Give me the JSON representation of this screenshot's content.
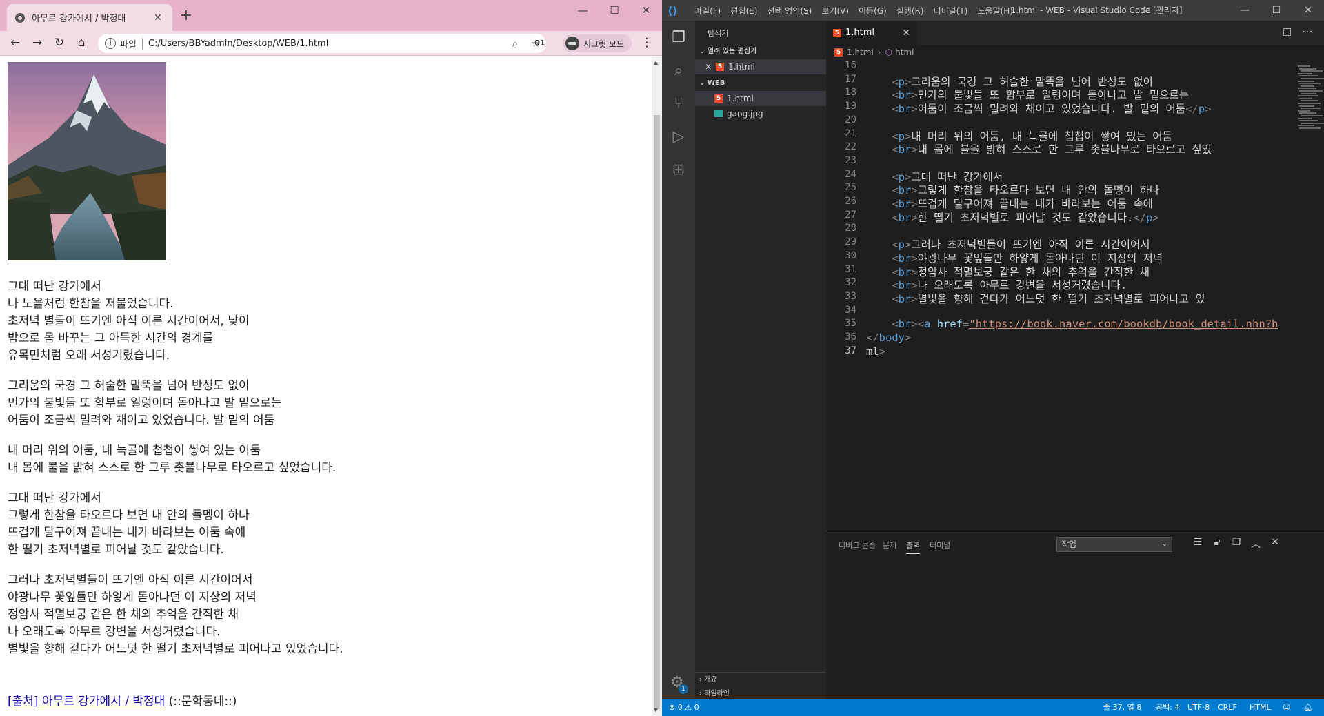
{
  "chrome": {
    "tab_title": "아무르 강가에서 / 박정대",
    "tab_close": "✕",
    "new_tab": "+",
    "win_min": "—",
    "win_max": "☐",
    "win_close": "✕",
    "back": "←",
    "forward": "→",
    "reload": "↻",
    "home": "⌂",
    "omnibox_label": "파일",
    "url": "C:/Users/BBYadmin/Desktop/WEB/1.html",
    "extension_badge": "01",
    "incognito_label": "시크릿 모드",
    "menu": "⋮"
  },
  "page": {
    "stanzas": [
      [
        "그대 떠난 강가에서",
        "나 노을처럼 한참을 저물었습니다.",
        "초저녁 별들이 뜨기엔 아직 이른 시간이어서, 낮이",
        "밤으로 몸 바꾸는 그 아득한 시간의 경계를",
        "유목민처럼 오래 서성거렸습니다."
      ],
      [
        "그리움의 국경 그 허술한 말뚝을 넘어 반성도 없이",
        "민가의 불빛들 또 함부로 일렁이며 돋아나고 발 밑으로는",
        "어둠이 조금씩 밀려와 채이고 있었습니다. 발 밑의 어둠"
      ],
      [
        "내 머리 위의 어둠, 내 늑골에 첩첩이 쌓여 있는 어둠",
        "내 몸에 불을 밝혀 스스로 한 그루 촛불나무로 타오르고 싶었습니다."
      ],
      [
        "그대 떠난 강가에서",
        "그렇게 한참을 타오르다 보면 내 안의 돌멩이 하나",
        "뜨겁게 달구어져 끝내는 내가 바라보는 어둠 속에",
        "한 떨기 초저녁별로 피어날 것도 같았습니다."
      ],
      [
        "그러나 초저녁별들이 뜨기엔 아직 이른 시간이어서",
        "야광나무 꽃잎들만 하얗게 돋아나던 이 지상의 저녁",
        "정암사 적멸보궁 같은 한 채의 추억을 간직한 채",
        "나 오래도록 아무르 강변을 서성거렸습니다.",
        "별빛을 향해 걷다가 어느덧 한 떨기 초저녁별로 피어나고 있었습니다."
      ]
    ],
    "source_link": "[출처] 아무르 강가에서 / 박정대",
    "source_suffix": " (::문학동네::)"
  },
  "vscode": {
    "menus": [
      "파일(F)",
      "편집(E)",
      "선택 영역(S)",
      "보기(V)",
      "이동(G)",
      "실행(R)",
      "터미널(T)",
      "도움말(H)"
    ],
    "title": "1.html - WEB - Visual Studio Code [관리자]",
    "sidebar_title": "탐색기",
    "open_editors": "열려 있는 편집기",
    "open_file": "1.html",
    "folder": "WEB",
    "files": [
      "1.html",
      "gang.jpg"
    ],
    "outline": "개요",
    "timeline": "타임라인",
    "editor_tab": "1.html",
    "breadcrumb_file": "1.html",
    "breadcrumb_node": "html",
    "code_lines": [
      {
        "n": "16",
        "t": ""
      },
      {
        "n": "17",
        "t": "    <p>그리움의 국경 그 허술한 말뚝을 넘어 반성도 없이"
      },
      {
        "n": "18",
        "t": "    <br>민가의 불빛들 또 함부로 일렁이며 돋아나고 발 밑으로는"
      },
      {
        "n": "19",
        "t": "    <br>어둠이 조금씩 밀려와 채이고 있었습니다. 발 밑의 어둠</p>"
      },
      {
        "n": "20",
        "t": ""
      },
      {
        "n": "21",
        "t": "    <p>내 머리 위의 어둠, 내 늑골에 첩첩이 쌓여 있는 어둠"
      },
      {
        "n": "22",
        "t": "    <br>내 몸에 불을 밝혀 스스로 한 그루 촛불나무로 타오르고 싶었"
      },
      {
        "n": "23",
        "t": ""
      },
      {
        "n": "24",
        "t": "    <p>그대 떠난 강가에서"
      },
      {
        "n": "25",
        "t": "    <br>그렇게 한참을 타오르다 보면 내 안의 돌멩이 하나"
      },
      {
        "n": "26",
        "t": "    <br>뜨겁게 달구어져 끝내는 내가 바라보는 어둠 속에"
      },
      {
        "n": "27",
        "t": "    <br>한 떨기 초저녁별로 피어날 것도 같았습니다.</p>"
      },
      {
        "n": "28",
        "t": ""
      },
      {
        "n": "29",
        "t": "    <p>그러나 초저녁별들이 뜨기엔 아직 이른 시간이어서"
      },
      {
        "n": "30",
        "t": "    <br>야광나무 꽃잎들만 하얗게 돋아나던 이 지상의 저녁"
      },
      {
        "n": "31",
        "t": "    <br>정암사 적멸보궁 같은 한 채의 추억을 간직한 채"
      },
      {
        "n": "32",
        "t": "    <br>나 오래도록 아무르 강변을 서성거렸습니다."
      },
      {
        "n": "33",
        "t": "    <br>별빛을 향해 걷다가 어느덧 한 떨기 초저녁별로 피어나고 있"
      },
      {
        "n": "34",
        "t": ""
      },
      {
        "n": "35",
        "t": "    <br><a href=\"https://book.naver.com/bookdb/book_detail.nhn?b"
      },
      {
        "n": "36",
        "t": "</body>"
      },
      {
        "n": "37",
        "t": "ml>"
      }
    ],
    "panel_tabs": [
      "디버그 콘솔",
      "문제",
      "출력",
      "터미널"
    ],
    "panel_select": "작업",
    "status_errors": "⊗ 0 ⚠ 0",
    "status_position": "줄 37, 열 8",
    "status_spaces": "공백: 4",
    "status_encoding": "UTF-8",
    "status_eol": "CRLF",
    "status_lang": "HTML",
    "badge": "1"
  }
}
